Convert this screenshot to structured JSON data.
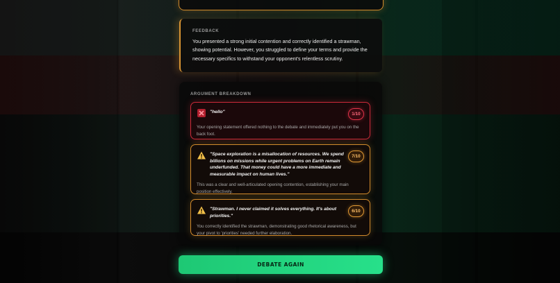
{
  "feedback": {
    "label": "FEEDBACK",
    "text": "You presented a strong initial contention and correctly identified a strawman, showing potential. However, you struggled to define your terms and provide the necessary specifics to withstand your opponent's relentless scrutiny."
  },
  "breakdown": {
    "label": "ARGUMENT BREAKDOWN",
    "items": [
      {
        "icon": "x-icon",
        "quote": "\"hello\"",
        "score": "1/10",
        "comment": "Your opening statement offered nothing to the debate and immediately put you on the back foot.",
        "status_color": "#cc2a3a"
      },
      {
        "icon": "warning-icon",
        "quote": "\"Space exploration is a misallocation of resources. We spend billions on missions while urgent problems on Earth remain underfunded. That money could have a more immediate and measurable impact on human lives.\"",
        "score": "7/10",
        "comment": "This was a clear and well-articulated opening contention, establishing your main position effectively.",
        "status_color": "#d28a2c"
      },
      {
        "icon": "warning-icon",
        "quote": "\"Strawman. I never claimed it solves everything. It's about priorities.\"",
        "score": "6/10",
        "comment": "You correctly identified the strawman, demonstrating good rhetorical awareness, but your pivot to 'priorities' needed further elaboration.",
        "status_color": "#d28a2c"
      }
    ]
  },
  "cta": {
    "label": "DEBATE AGAIN",
    "color": "#27e08a"
  }
}
